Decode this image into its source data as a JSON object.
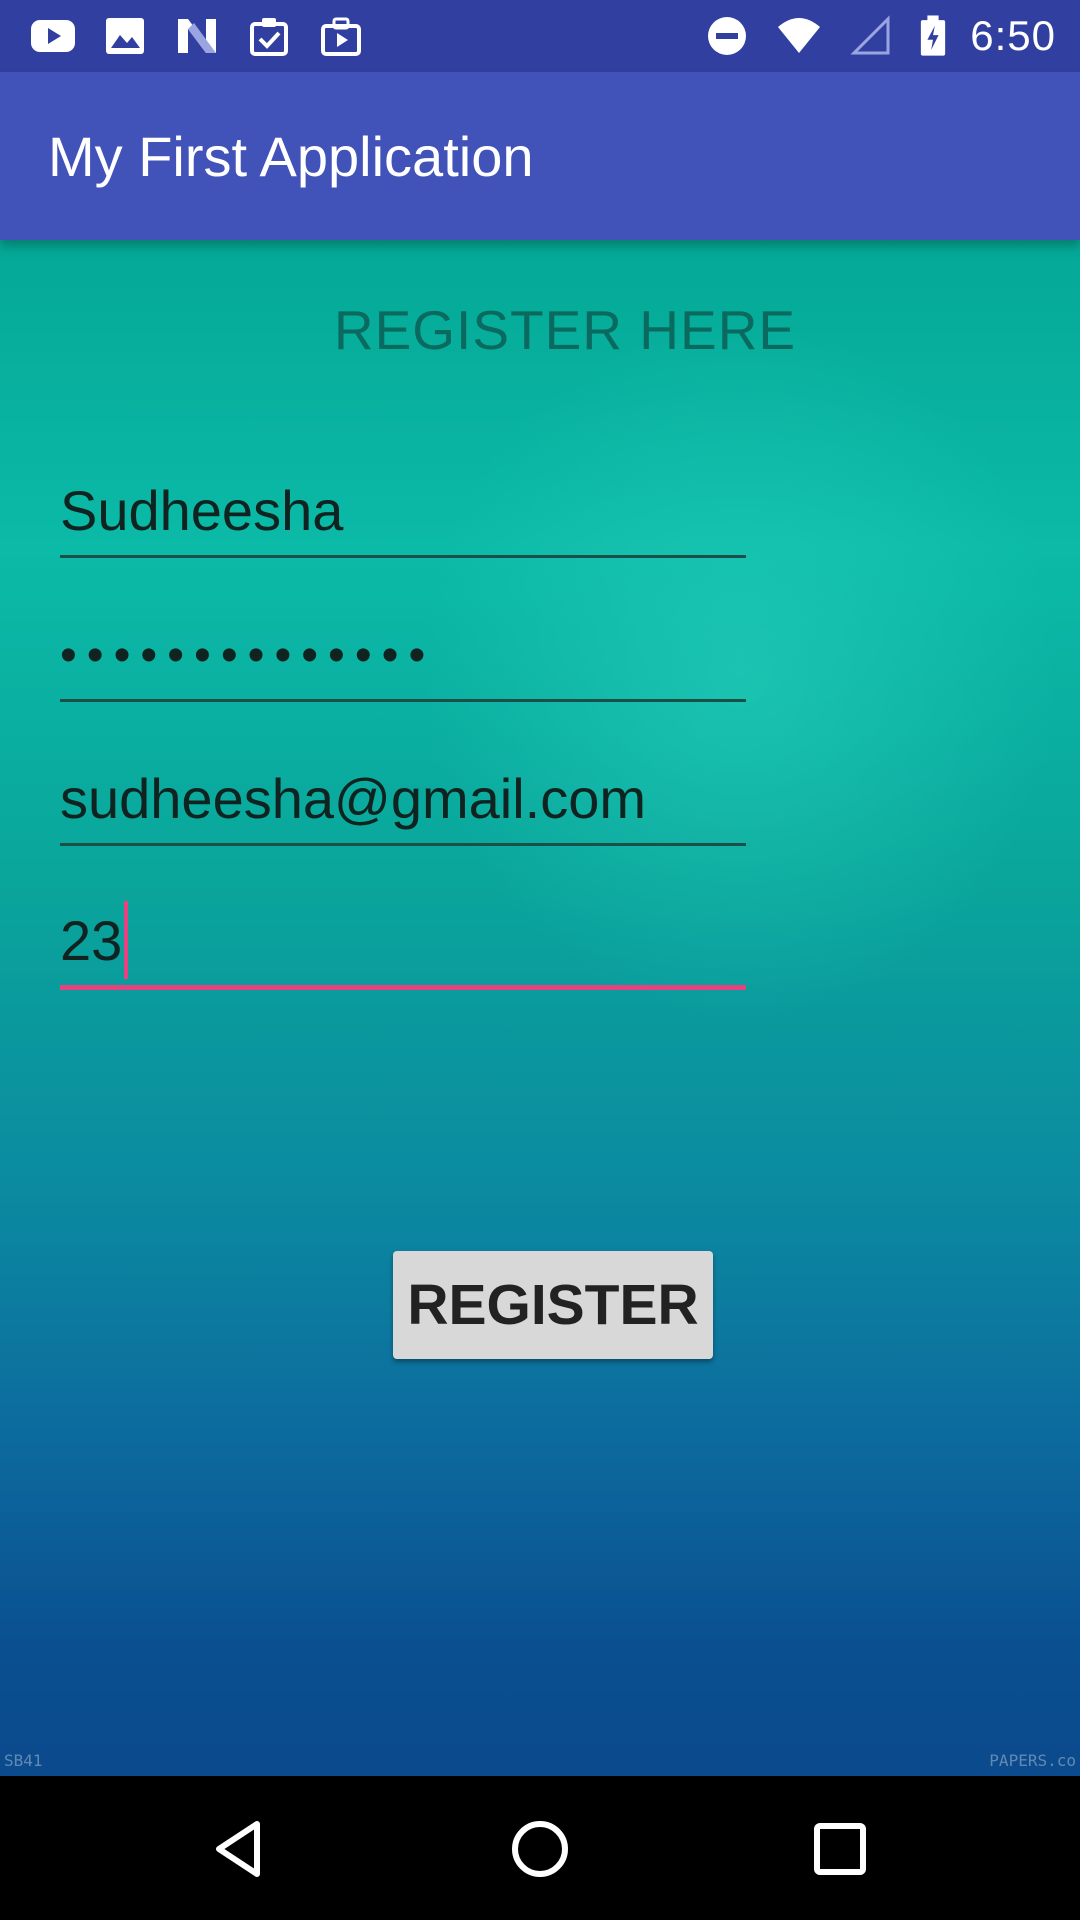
{
  "status_bar": {
    "time": "6:50",
    "left_icons": [
      "youtube-icon",
      "image-icon",
      "n-logo-icon",
      "clipboard-check-icon",
      "briefcase-play-icon"
    ],
    "right_icons": [
      "do-not-disturb-icon",
      "wifi-icon",
      "cell-signal-icon",
      "battery-charging-icon"
    ]
  },
  "app_bar": {
    "title": "My First Application",
    "color": "#4152b8"
  },
  "form": {
    "heading": "REGISTER HERE",
    "username": "Sudheesha",
    "password_mask": "••••••••••••••",
    "email": "sudheesha@gmail.com",
    "age": "23",
    "submit_label": "REGISTER",
    "accent_color": "#e8417f"
  },
  "watermark": {
    "left": "SB41",
    "right": "PAPERS.co"
  },
  "nav_bar": {
    "buttons": [
      "back-icon",
      "home-icon",
      "recents-icon"
    ]
  }
}
